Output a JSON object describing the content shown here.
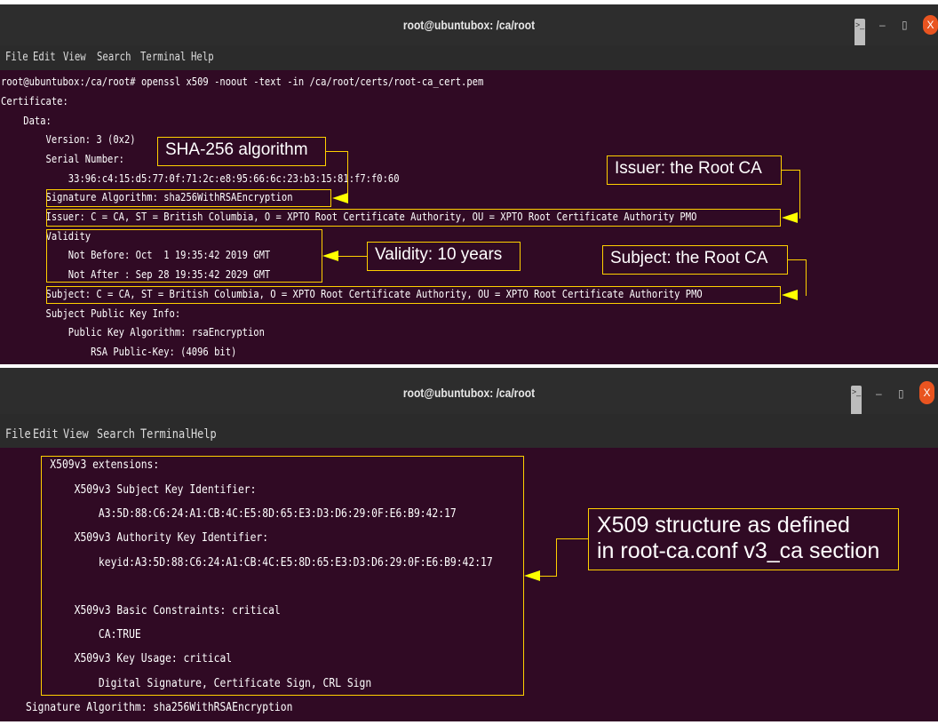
{
  "window_title": "root@ubuntubox: /ca/root",
  "window_controls": {
    "terminal": ">_",
    "minimize": "–",
    "maximize": "▯",
    "close": "X"
  },
  "menu": [
    "File",
    "Edit",
    "View",
    "Search",
    "Terminal",
    "Help"
  ],
  "top_terminal": {
    "lines": [
      "root@ubuntubox:/ca/root# openssl x509 -noout -text -in /ca/root/certs/root-ca_cert.pem",
      "Certificate:",
      "    Data:",
      "        Version: 3 (0x2)",
      "        Serial Number:",
      "            33:96:c4:15:d5:77:0f:71:2c:e8:95:66:6c:23:b3:15:81:f7:f0:60",
      "        Signature Algorithm: sha256WithRSAEncryption",
      "        Issuer: C = CA, ST = British Columbia, O = XPTO Root Certificate Authority, OU = XPTO Root Certificate Authority PMO",
      "        Validity",
      "            Not Before: Oct  1 19:35:42 2019 GMT",
      "            Not After : Sep 28 19:35:42 2029 GMT",
      "        Subject: C = CA, ST = British Columbia, O = XPTO Root Certificate Authority, OU = XPTO Root Certificate Authority PMO",
      "        Subject Public Key Info:",
      "            Public Key Algorithm: rsaEncryption",
      "                RSA Public-Key: (4096 bit)"
    ]
  },
  "bottom_terminal": {
    "lines": [
      "    X509v3 extensions:",
      "        X509v3 Subject Key Identifier:",
      "            A3:5D:88:C6:24:A1:CB:4C:E5:8D:65:E3:D3:D6:29:0F:E6:B9:42:17",
      "        X509v3 Authority Key Identifier:",
      "            keyid:A3:5D:88:C6:24:A1:CB:4C:E5:8D:65:E3:D3:D6:29:0F:E6:B9:42:17",
      "",
      "        X509v3 Basic Constraints: critical",
      "            CA:TRUE",
      "        X509v3 Key Usage: critical",
      "            Digital Signature, Certificate Sign, CRL Sign",
      "Signature Algorithm: sha256WithRSAEncryption"
    ]
  },
  "annotations": {
    "sha": "SHA-256 algorithm",
    "issuer": "Issuer: the Root CA",
    "validity": "Validity: 10 years",
    "subject": "Subject: the Root CA",
    "x509_line1": "X509 structure as defined",
    "x509_line2": "in root-ca.conf v3_ca section"
  },
  "colors": {
    "terminal_bg": "#300a24",
    "titlebar_bg": "#2d2d2d",
    "highlight": "#ffd000",
    "arrow": "#ffff00",
    "close_button": "#e95420"
  }
}
